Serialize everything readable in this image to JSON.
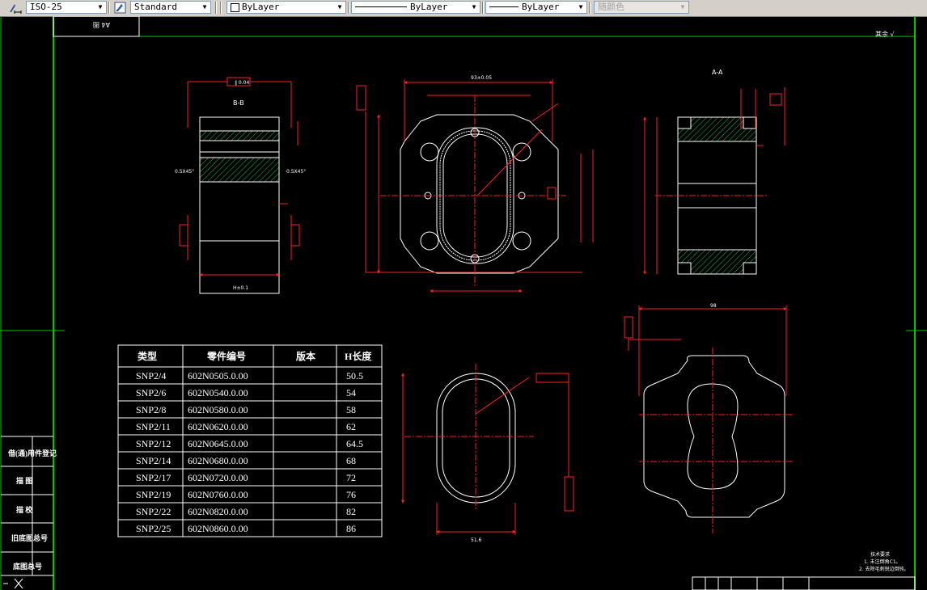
{
  "toolbar": {
    "dimstyle": "ISO-25",
    "textstyle": "Standard",
    "layer": "ByLayer",
    "linetype": "ByLayer",
    "lineweight": "ByLayer",
    "color": "随颜色"
  },
  "sheet": {
    "title_block_tag": "A4 图",
    "top_right_note": "其余 √",
    "notes_title": "技术要求",
    "notes": [
      "1. 未注倒角C1。",
      "2. 去除毛刺锐边倒钝。"
    ]
  },
  "views": {
    "section_bb": "B-B",
    "section_aa": "A-A",
    "top_width_dim": "93±0.05",
    "bottom_width_dim": "98",
    "oval_width_dim": "51.6",
    "left_bottom_dim": "H±0.1",
    "chamfer_left": "0.5X45°",
    "chamfer_right": "0.5X45°"
  },
  "parts_table": {
    "headers": [
      "类型",
      "零件编号",
      "版本",
      "H长度"
    ],
    "rows": [
      [
        "SNP2/4",
        "602N0505.0.00",
        "",
        "50.5"
      ],
      [
        "SNP2/6",
        "602N0540.0.00",
        "",
        "54"
      ],
      [
        "SNP2/8",
        "602N0580.0.00",
        "",
        "58"
      ],
      [
        "SNP2/11",
        "602N0620.0.00",
        "",
        "62"
      ],
      [
        "SNP2/12",
        "602N0645.0.00",
        "",
        "64.5"
      ],
      [
        "SNP2/14",
        "602N0680.0.00",
        "",
        "68"
      ],
      [
        "SNP2/17",
        "602N0720.0.00",
        "",
        "72"
      ],
      [
        "SNP2/19",
        "602N0760.0.00",
        "",
        "76"
      ],
      [
        "SNP2/22",
        "602N0820.0.00",
        "",
        "82"
      ],
      [
        "SNP2/25",
        "602N0860.0.00",
        "",
        "86"
      ]
    ]
  },
  "side_labels": [
    "借(通)用件登记",
    "描 图",
    "描 校",
    "旧底图总号",
    "底图总号"
  ],
  "colors": {
    "green": "#00c800",
    "red": "#ff2020",
    "hatch": "#20c040",
    "toolbar_bg": "#d4d0c8"
  },
  "icons": [
    "dimension-style-icon",
    "text-style-icon",
    "cross-icon"
  ]
}
